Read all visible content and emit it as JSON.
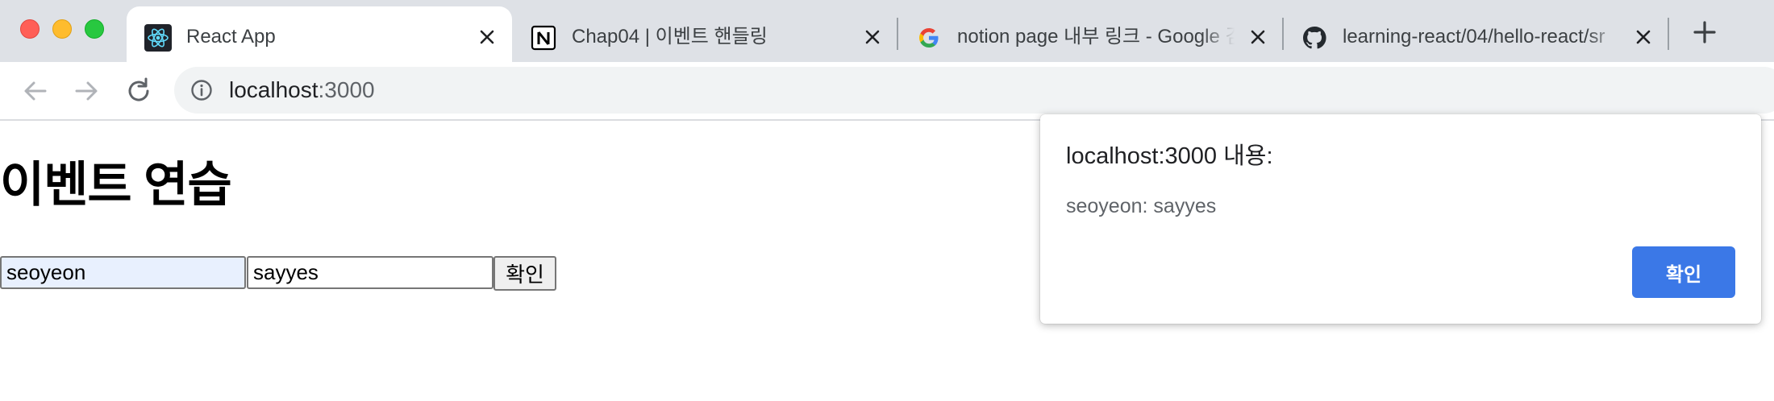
{
  "browser": {
    "tabs": [
      {
        "title": "React App",
        "favicon": "react-icon",
        "active": true
      },
      {
        "title": "Chap04 | 이벤트 핸들링",
        "favicon": "notion-icon",
        "active": false
      },
      {
        "title": "notion page 내부 링크 - Google 검",
        "favicon": "google-icon",
        "active": false
      },
      {
        "title": "learning-react/04/hello-react/sr",
        "favicon": "github-icon",
        "active": false
      }
    ],
    "address": {
      "host": "localhost",
      "port": ":3000"
    }
  },
  "page": {
    "heading": "이벤트 연습",
    "input1_value": "seoyeon",
    "input2_value": "sayyes",
    "confirm_label": "확인"
  },
  "dialog": {
    "title": "localhost:3000 내용:",
    "message": "seoyeon: sayyes",
    "ok_label": "확인"
  },
  "colors": {
    "tabstrip_bg": "#dee1e6",
    "dialog_button": "#3b78e7",
    "autofill_bg": "#e8f0fe"
  }
}
